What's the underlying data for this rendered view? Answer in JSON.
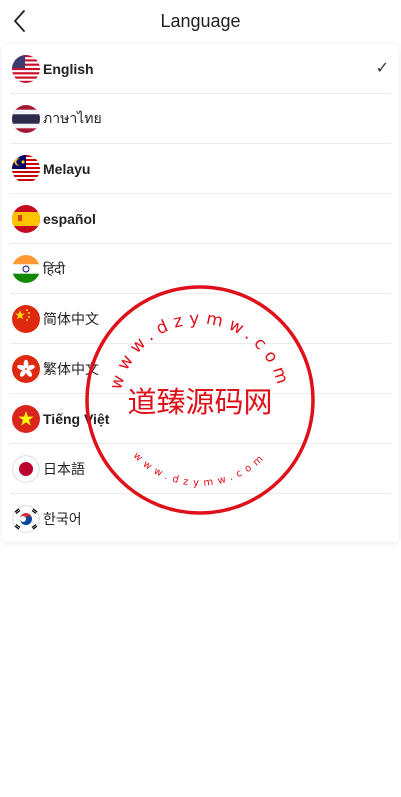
{
  "header": {
    "title": "Language",
    "back_icon": "chevron-left-icon"
  },
  "languages": [
    {
      "label": "English",
      "flag": "us-flag-icon",
      "selected": true
    },
    {
      "label": "ภาษาไทย",
      "flag": "thailand-flag-icon",
      "selected": false
    },
    {
      "label": "Melayu",
      "flag": "malaysia-flag-icon",
      "selected": false
    },
    {
      "label": "español",
      "flag": "spain-flag-icon",
      "selected": false
    },
    {
      "label": "हिंदी",
      "flag": "india-flag-icon",
      "selected": false
    },
    {
      "label": "简体中文",
      "flag": "china-flag-icon",
      "selected": false
    },
    {
      "label": "繁体中文",
      "flag": "hongkong-flag-icon",
      "selected": false
    },
    {
      "label": "Tiếng Việt",
      "flag": "vietnam-flag-icon",
      "selected": false
    },
    {
      "label": "日本語",
      "flag": "japan-flag-icon",
      "selected": false
    },
    {
      "label": "한국어",
      "flag": "korea-flag-icon",
      "selected": false
    }
  ],
  "selected_mark": "✓",
  "watermark": {
    "center_text": "道臻源码网",
    "top_text": "www.dzymw.com",
    "bottom_text": "www.dzymw.com",
    "color": "#e0101a"
  }
}
